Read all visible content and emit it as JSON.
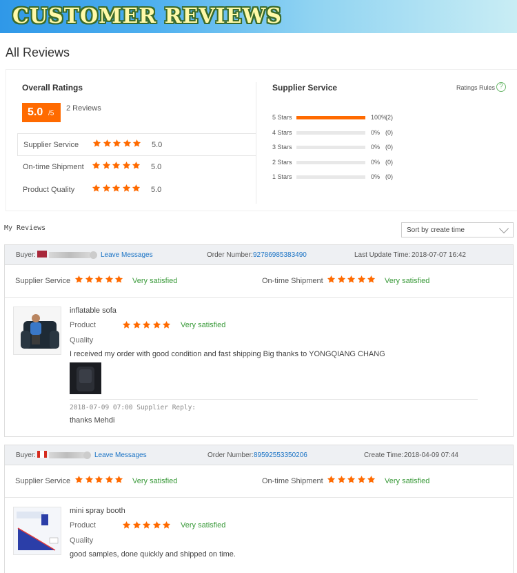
{
  "banner": {
    "title": "CUSTOMER REVIEWS"
  },
  "page": {
    "heading": "All Reviews"
  },
  "overall": {
    "title": "Overall Ratings",
    "score": "5.0",
    "out_of": "/5",
    "reviews_count": "2 Reviews",
    "rows": [
      {
        "label": "Supplier Service",
        "stars": 5,
        "value": "5.0"
      },
      {
        "label": "On-time Shipment",
        "stars": 5,
        "value": "5.0"
      },
      {
        "label": "Product Quality",
        "stars": 5,
        "value": "5.0"
      }
    ]
  },
  "supplier_service": {
    "title": "Supplier Service",
    "rules_label": "Ratings Rules",
    "rules_icon": "question-circle-icon",
    "distribution": [
      {
        "label": "5 Stars",
        "fraction": 1.0,
        "percent": "100%",
        "count": "(2)"
      },
      {
        "label": "4 Stars",
        "fraction": 0,
        "percent": "0%",
        "count": "(0)"
      },
      {
        "label": "3 Stars",
        "fraction": 0,
        "percent": "0%",
        "count": "(0)"
      },
      {
        "label": "2 Stars",
        "fraction": 0,
        "percent": "0%",
        "count": "(0)"
      },
      {
        "label": "1 Stars",
        "fraction": 0,
        "percent": "0%",
        "count": "(0)"
      }
    ]
  },
  "my_reviews": {
    "title": "My Reviews",
    "sort_value": "Sort by create time"
  },
  "colors": {
    "accent": "#ff6a00",
    "link": "#1a73c5",
    "satisfied": "#3a9a3a"
  },
  "reviews": [
    {
      "buyer_label": "Buyer:",
      "leave_messages": "Leave Messages",
      "order_label": "Order Number:",
      "order_number": "92786985383490",
      "time_label": "Last Update Time:",
      "time_value": "2018-07-07 16:42",
      "supplier_service_label": "Supplier Service",
      "supplier_service_text": "Very satisfied",
      "shipment_label": "On-time Shipment",
      "shipment_text": "Very satisfied",
      "product_name": "inflatable sofa",
      "product_label": "Product",
      "product_text": "Very satisfied",
      "quality_label": "Quality",
      "comment": "I received my order with good condition and fast shipping Big thanks to YONGQIANG CHANG",
      "reply_meta": "2018-07-09 07:00  Supplier Reply:",
      "reply_text": "thanks Mehdi"
    },
    {
      "buyer_label": "Buyer:",
      "leave_messages": "Leave Messages",
      "order_label": "Order Number:",
      "order_number": "89592553350206",
      "time_label": "Create Time:",
      "time_value": "2018-04-09 07:44",
      "supplier_service_label": "Supplier Service",
      "supplier_service_text": "Very satisfied",
      "shipment_label": "On-time Shipment",
      "shipment_text": "Very satisfied",
      "product_name": "mini spray booth",
      "product_label": "Product",
      "product_text": "Very satisfied",
      "quality_label": "Quality",
      "comment": "good samples, done quickly and shipped on time."
    }
  ]
}
